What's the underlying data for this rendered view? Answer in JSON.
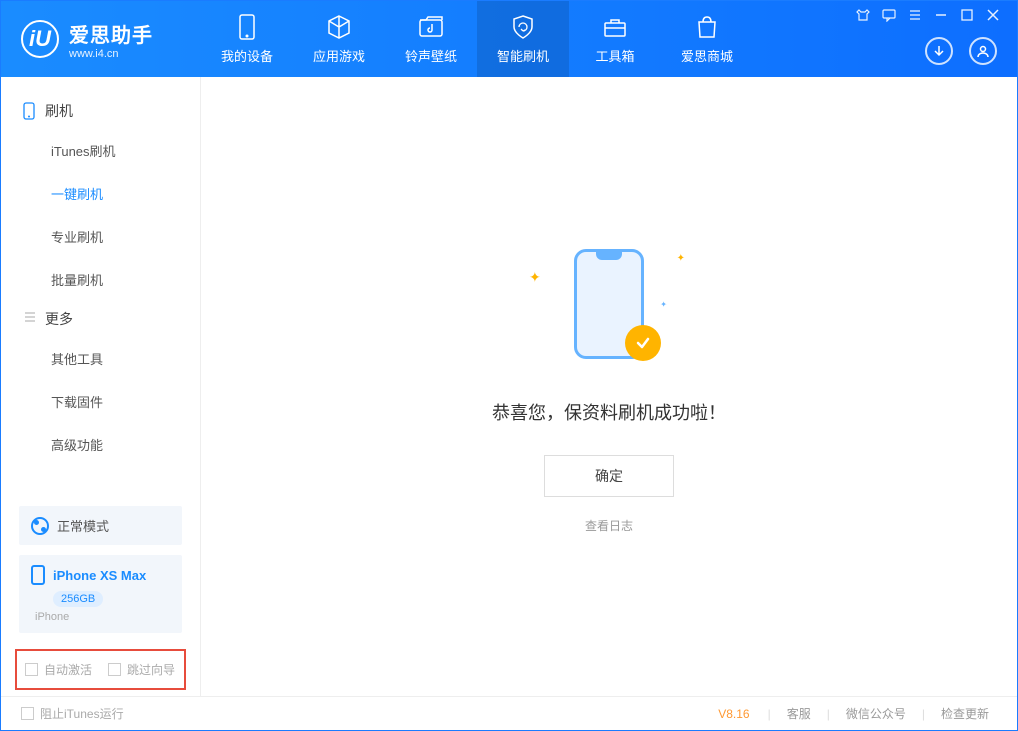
{
  "brand": {
    "title": "爱思助手",
    "url": "www.i4.cn",
    "logo_letter": "iU"
  },
  "nav": {
    "tabs": [
      {
        "label": "我的设备"
      },
      {
        "label": "应用游戏"
      },
      {
        "label": "铃声壁纸"
      },
      {
        "label": "智能刷机"
      },
      {
        "label": "工具箱"
      },
      {
        "label": "爱思商城"
      }
    ]
  },
  "sidebar": {
    "section1": {
      "title": "刷机"
    },
    "items1": [
      {
        "label": "iTunes刷机"
      },
      {
        "label": "一键刷机"
      },
      {
        "label": "专业刷机"
      },
      {
        "label": "批量刷机"
      }
    ],
    "section2": {
      "title": "更多"
    },
    "items2": [
      {
        "label": "其他工具"
      },
      {
        "label": "下载固件"
      },
      {
        "label": "高级功能"
      }
    ]
  },
  "mode": {
    "label": "正常模式"
  },
  "device": {
    "name": "iPhone XS Max",
    "storage": "256GB",
    "type": "iPhone"
  },
  "checkboxes": {
    "auto_activate": "自动激活",
    "skip_guide": "跳过向导"
  },
  "main": {
    "success_message": "恭喜您，保资料刷机成功啦！",
    "ok_button": "确定",
    "view_log": "查看日志"
  },
  "footer": {
    "block_itunes": "阻止iTunes运行",
    "version": "V8.16",
    "links": {
      "support": "客服",
      "wechat": "微信公众号",
      "update": "检查更新"
    }
  }
}
